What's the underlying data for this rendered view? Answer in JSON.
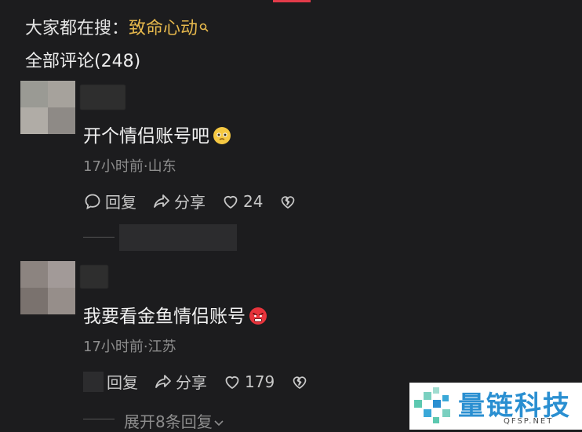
{
  "trending": {
    "prefix": "大家都在搜：",
    "keyword": "致命心动"
  },
  "comments_header": {
    "title": "全部评论(248)"
  },
  "comments": [
    {
      "text": "开个情侣账号吧",
      "emoji_icon": "pleading-face-emoji",
      "meta": "17小时前·山东",
      "reply_label": "回复",
      "share_label": "分享",
      "like_count": "24"
    },
    {
      "text": "我要看金鱼情侣账号",
      "emoji_icon": "angry-face-emoji",
      "meta": "17小时前·江苏",
      "reply_label": "回复",
      "share_label": "分享",
      "like_count": "179",
      "expand_label": "展开8条回复"
    }
  ],
  "watermark": {
    "title": "量链科技",
    "subtitle": "QFSP.NET"
  },
  "colors": {
    "accent": "#e23b4a",
    "keyword": "#e6b84c",
    "background": "#1c1c1e",
    "logo": "#2a8fd1"
  }
}
